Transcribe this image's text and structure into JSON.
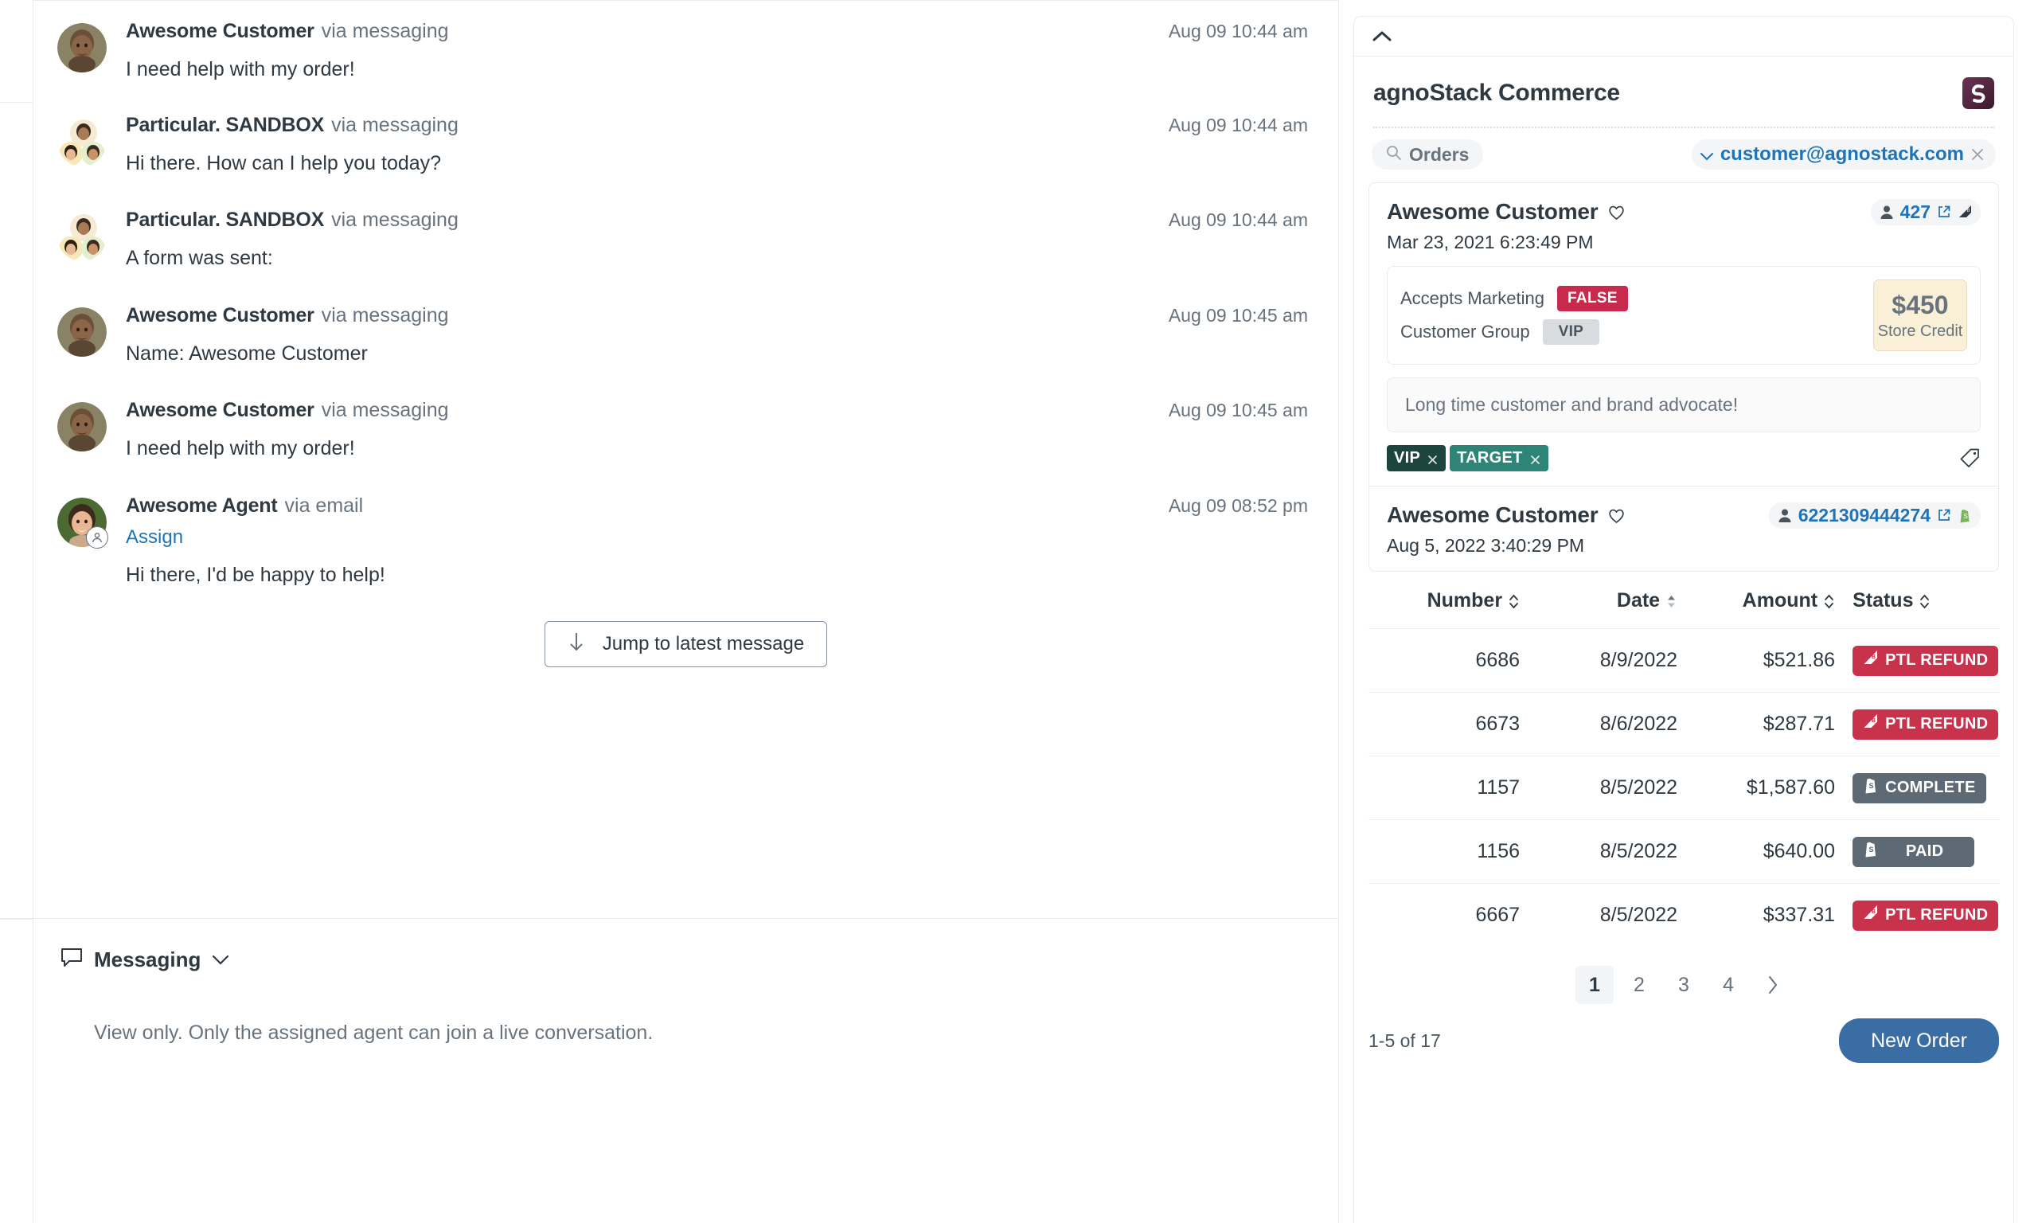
{
  "conversation": {
    "messages": [
      {
        "author": "Awesome Customer",
        "via": "via messaging",
        "time": "Aug 09 10:44 am",
        "text": "I need help with my order!",
        "avatar": "man-avatar"
      },
      {
        "author": "Particular. SANDBOX",
        "via": "via messaging",
        "time": "Aug 09 10:44 am",
        "text": "Hi there. How can I help you today?",
        "avatar": "group-avatar"
      },
      {
        "author": "Particular. SANDBOX",
        "via": "via messaging",
        "time": "Aug 09 10:44 am",
        "text": "A form was sent:",
        "avatar": "group-avatar"
      },
      {
        "author": "Awesome Customer",
        "via": "via messaging",
        "time": "Aug 09 10:45 am",
        "text": "Name: Awesome Customer",
        "avatar": "man-avatar"
      },
      {
        "author": "Awesome Customer",
        "via": "via messaging",
        "time": "Aug 09 10:45 am",
        "text": "I need help with my order!",
        "avatar": "man-avatar"
      },
      {
        "author": "Awesome Agent",
        "via": "via email",
        "time": "Aug 09 08:52 pm",
        "text": "Hi there, I'd be happy to help!",
        "avatar": "woman-avatar",
        "assign_label": "Assign"
      }
    ],
    "jump_button": "Jump to latest message",
    "composer": {
      "channel_label": "Messaging",
      "view_only_notice": "View only. Only the assigned agent can join a live conversation."
    }
  },
  "app_panel": {
    "title": "agnoStack Commerce",
    "logo_name": "agnostack-logo",
    "logo_color": "#5b2a47",
    "search_chip": "Orders",
    "email_chip": "customer@agnostack.com",
    "customers": [
      {
        "name": "Awesome Customer",
        "date": "Mar 23, 2021 6:23:49 PM",
        "id": "427",
        "platform": "bigcommerce",
        "attributes": [
          {
            "label": "Accepts Marketing",
            "value": "FALSE",
            "style": "false"
          },
          {
            "label": "Customer Group",
            "value": "VIP",
            "style": "neutral"
          }
        ],
        "store_credit_amount": "$450",
        "store_credit_label": "Store Credit",
        "note": "Long time customer and brand advocate!",
        "tags": [
          {
            "label": "VIP",
            "color": "#1d4540"
          },
          {
            "label": "TARGET",
            "color": "#2e8577"
          }
        ]
      },
      {
        "name": "Awesome Customer",
        "date": "Aug 5, 2022 3:40:29 PM",
        "id": "6221309444274",
        "platform": "shopify"
      }
    ],
    "orders_table": {
      "columns": [
        "Number",
        "Date",
        "Amount",
        "Status"
      ],
      "rows": [
        {
          "number": "6686",
          "date": "8/9/2022",
          "amount": "$521.86",
          "status": "PTL REFUND",
          "status_style": "red",
          "status_icon": "bigcommerce-icon"
        },
        {
          "number": "6673",
          "date": "8/6/2022",
          "amount": "$287.71",
          "status": "PTL REFUND",
          "status_style": "red",
          "status_icon": "bigcommerce-icon"
        },
        {
          "number": "1157",
          "date": "8/5/2022",
          "amount": "$1,587.60",
          "status": "COMPLETE",
          "status_style": "gray",
          "status_icon": "shopify-icon"
        },
        {
          "number": "1156",
          "date": "8/5/2022",
          "amount": "$640.00",
          "status": "PAID",
          "status_style": "gray",
          "status_icon": "shopify-icon"
        },
        {
          "number": "6667",
          "date": "8/5/2022",
          "amount": "$337.31",
          "status": "PTL REFUND",
          "status_style": "red",
          "status_icon": "bigcommerce-icon"
        }
      ]
    },
    "pagination": {
      "pages": [
        "1",
        "2",
        "3",
        "4"
      ],
      "active": "1"
    },
    "result_count": "1-5 of 17",
    "new_order_button": "New Order",
    "accent_color": "#3a6da4"
  }
}
